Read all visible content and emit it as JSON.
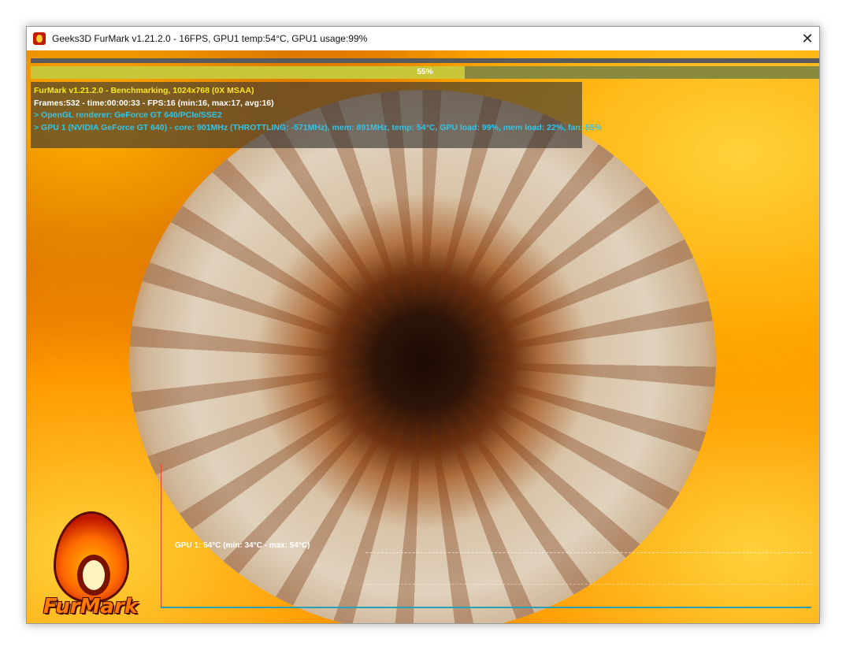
{
  "window": {
    "title": "Geeks3D FurMark v1.21.2.0 - 16FPS, GPU1 temp:54°C, GPU1 usage:99%",
    "close_glyph": "✕"
  },
  "progress": {
    "label": "55%",
    "fraction": 0.55
  },
  "info": {
    "line1": "FurMark v1.21.2.0 - Benchmarking, 1024x768 (0X MSAA)",
    "line2": "Frames:532 - time:00:00:33 - FPS:16 (min:16, max:17, avg:16)",
    "line3": "> OpenGL renderer: GeForce GT 640/PCIe/SSE2",
    "line4": "> GPU 1 (NVIDIA GeForce GT 640) - core: 901MHz (THROTTLING: -571MHz), mem: 891MHz, temp: 54°C, GPU load: 99%, mem load: 22%, fan: 55%"
  },
  "graph": {
    "label": "GPU 1: 54°C (min: 34°C - max: 54°C)"
  },
  "logo": {
    "text": "FurMark"
  },
  "colors": {
    "info_title": "#f8e820",
    "info_stats": "#ffffff",
    "info_gpu": "#31c5e8",
    "progress_fill": "#c9c63a",
    "graph_axis": "#2a9fb8"
  }
}
